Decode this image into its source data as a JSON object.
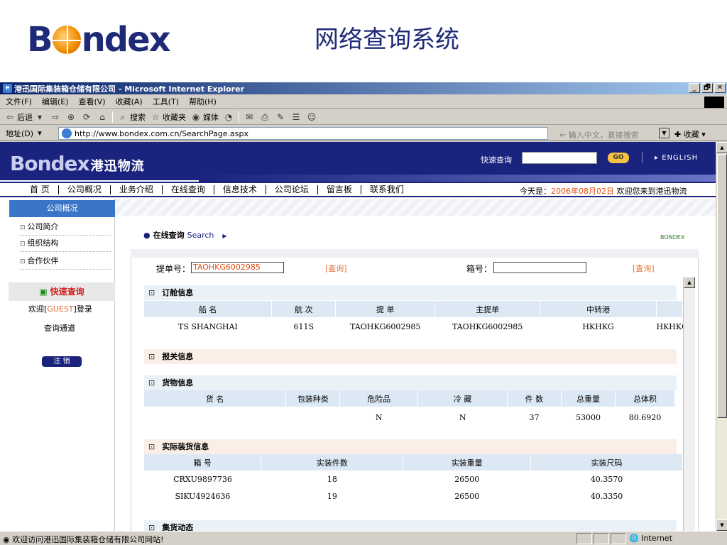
{
  "slide": {
    "logo_text_left": "B",
    "logo_text_right": "ndex",
    "title": "网络查询系统"
  },
  "window": {
    "title": "港迅国际集装箱仓储有限公司 - Microsoft Internet Explorer",
    "min": "_",
    "restore": "🗗",
    "close": "✕"
  },
  "menu": [
    "文件(F)",
    "编辑(E)",
    "查看(V)",
    "收藏(A)",
    "工具(T)",
    "帮助(H)"
  ],
  "toolbar": {
    "back": "后退",
    "search": "搜索",
    "favorites": "收藏夹",
    "media": "媒体"
  },
  "address": {
    "label": "地址(D)",
    "url": "http://www.bondex.com.cn/SearchPage.aspx",
    "search_hint": "输入中文，直接搜索",
    "fav_button": "收藏"
  },
  "site": {
    "logo": "Bondex",
    "logo_cn": "港迅物流",
    "quick_label": "快速查询",
    "go": "GO",
    "english": "▸ ENGLISH",
    "nav": [
      "首 页",
      "公司概况",
      "业务介绍",
      "在线查询",
      "信息技术",
      "公司论坛",
      "留言板",
      "联系我们"
    ],
    "today_prefix": "今天是：",
    "today_date": "2006年08月02日",
    "today_suffix": "欢迎您来到港迅物流"
  },
  "sidebar": {
    "head": "公司概况",
    "items": [
      "公司简介",
      "组织结构",
      "合作伙伴"
    ],
    "quick_query": "快速查询",
    "welcome_prefix": "欢迎[",
    "guest": "GUEST",
    "welcome_suffix": "]登录",
    "channel": "查询通道",
    "logout": "注 销"
  },
  "main": {
    "crumb_cn": "在线查询",
    "crumb_en": "Search",
    "bondex_tag": "BONDEX",
    "bill_label": "提单号：",
    "bill_value": "TAOHKG6002985",
    "query1": "[查询]",
    "container_label": "箱号：",
    "query2": "[查询]"
  },
  "booking": {
    "title": "订舱信息",
    "headers": [
      "船 名",
      "航 次",
      "提 单",
      "主提单",
      "中转港",
      ""
    ],
    "row": [
      "TS SHANGHAI",
      "611S",
      "TAOHKG6002985",
      "TAOHKG6002985",
      "HKHKG",
      "HKHKG"
    ]
  },
  "customs": {
    "title": "报关信息"
  },
  "cargo": {
    "title": "货物信息",
    "headers": [
      "货 名",
      "包装种类",
      "危险品",
      "冷 藏",
      "件 数",
      "总重量",
      "总体积"
    ],
    "row": [
      "",
      "",
      "N",
      "N",
      "37",
      "53000",
      "80.6920"
    ]
  },
  "loading": {
    "title": "实际装货信息",
    "headers": [
      "箱 号",
      "实装件数",
      "实装重量",
      "实装尺码"
    ],
    "rows": [
      [
        "CRXU9897736",
        "18",
        "26500",
        "40.3570"
      ],
      [
        "SIKU4924636",
        "19",
        "26500",
        "40.3350"
      ]
    ]
  },
  "dynamics": {
    "title": "集货动态"
  },
  "status": {
    "text": "欢迎访问港迅国际集装箱仓储有限公司网站!",
    "zone": "Internet"
  }
}
